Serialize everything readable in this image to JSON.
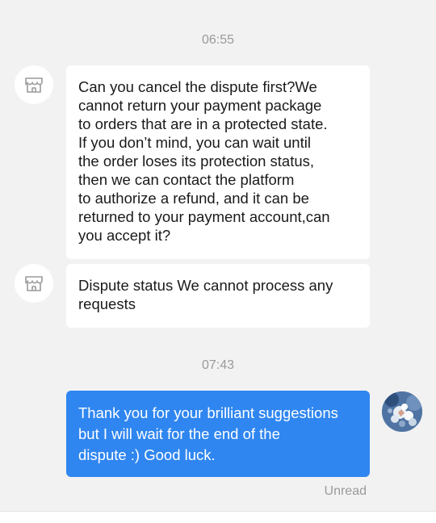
{
  "timestamps": [
    "06:55",
    "07:43"
  ],
  "messages": [
    {
      "sender": "seller",
      "text": "Can you cancel the dispute first?We\ncannot return your payment package\nto orders that are in a protected state.\nIf you don’t mind, you can wait until\nthe order loses its protection status,\nthen we can contact the platform\nto authorize a refund, and it can be\nreturned to your payment account,can\nyou accept it?"
    },
    {
      "sender": "seller",
      "text": "Dispute status We cannot process any\nrequests"
    },
    {
      "sender": "me",
      "text": "Thank you for your brilliant suggestions\nbut I will wait for the end of the\ndispute :) Good luck."
    }
  ],
  "read_status": "Unread",
  "colors": {
    "background": "#f2f2f2",
    "incoming_bubble": "#ffffff",
    "outgoing_bubble": "#2f86f0",
    "meta_text": "#9a9a9a"
  },
  "icons": {
    "seller_avatar": "store-icon",
    "user_avatar": "user-avatar-photo"
  }
}
